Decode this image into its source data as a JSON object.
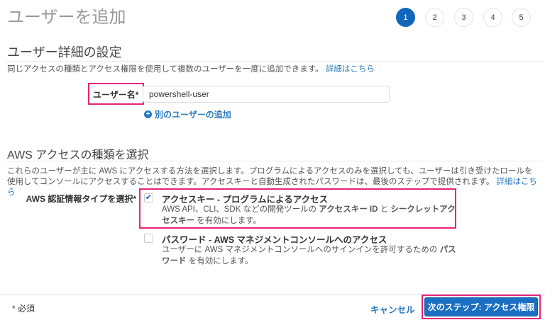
{
  "page_title": "ユーザーを追加",
  "steps": [
    "1",
    "2",
    "3",
    "4",
    "5"
  ],
  "active_step": 1,
  "details": {
    "heading": "ユーザー詳細の設定",
    "description": "同じアクセスの種類とアクセス権限を使用して複数のユーザーを一度に追加できます。",
    "learn_more": "詳細はこちら",
    "username_label": "ユーザー名*",
    "username_value": "powershell-user",
    "add_user_link": "別のユーザーの追加"
  },
  "access": {
    "heading": "AWS アクセスの種類を選択",
    "description": "これらのユーザーが主に AWS にアクセスする方法を選択します。プログラムによるアクセスのみを選択しても、ユーザーは引き受けたロールを使用してコンソールにアクセスすることはできます。アクセスキーと自動生成されたパスワードは、最後のステップで提供されます。",
    "learn_more": "詳細はこちら",
    "type_label": "AWS 認証情報タイプを選択*",
    "options": [
      {
        "title": "アクセスキー - プログラムによるアクセス",
        "desc_1": "AWS API、CLI、SDK などの開発ツールの ",
        "bold_1": "アクセスキー ID",
        "desc_2": " と ",
        "bold_2": "シークレットアクセスキー",
        "desc_3": " を有効にします。",
        "checked": true
      },
      {
        "title": "パスワード - AWS マネジメントコンソールへのアクセス",
        "desc_1": "ユーザーに AWS マネジメントコンソールへのサインインを許可するための ",
        "bold_1": "パスワード",
        "desc_3": " を有効にします。",
        "checked": false
      }
    ]
  },
  "footer": {
    "required_note": "* 必須",
    "cancel": "キャンセル",
    "next": "次のステップ: アクセス権限"
  }
}
